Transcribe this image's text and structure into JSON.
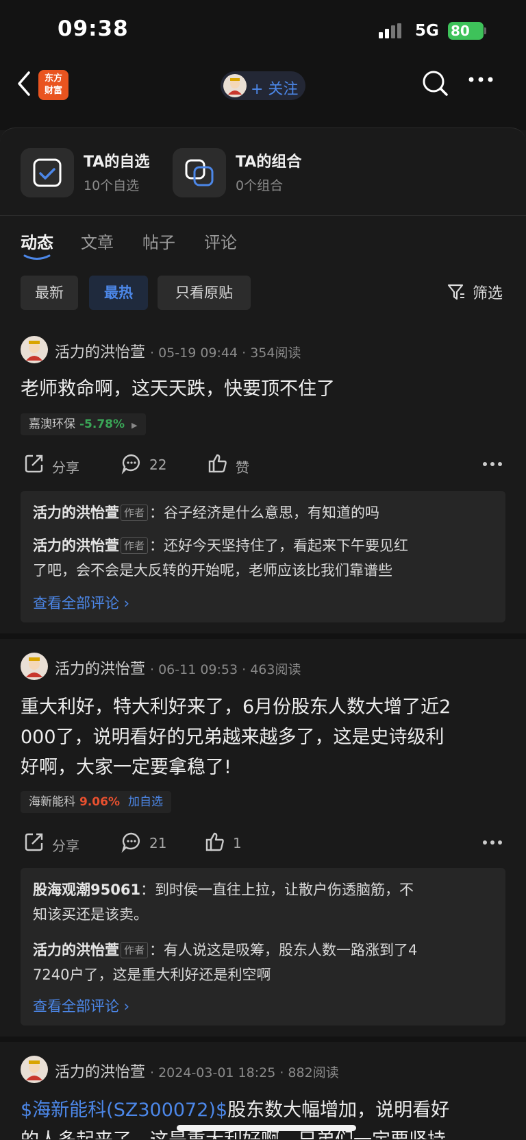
{
  "status": {
    "time": "09:38",
    "network": "5G",
    "battery": "80"
  },
  "nav": {
    "logo_text": "东方\n财富",
    "follow": "+ 关注"
  },
  "cards": [
    {
      "title": "TA的自选",
      "sub": "10个自选"
    },
    {
      "title": "TA的组合",
      "sub": "0个组合"
    }
  ],
  "tabs": [
    "动态",
    "文章",
    "帖子",
    "评论"
  ],
  "chips": [
    "最新",
    "最热",
    "只看原贴"
  ],
  "filter": "筛选",
  "posts": [
    {
      "author": "活力的洪怡萱",
      "meta": "· 05-19 09:44 · 354阅读",
      "lines": [
        "老师救命啊，这天天跌，快要顶不住了"
      ],
      "stock_name": "嘉澳环保",
      "stock_change": "-5.78%",
      "share": "分享",
      "comments": "22",
      "likes": "赞",
      "replies": [
        {
          "name": "活力的洪怡萱",
          "tag": "作者",
          "lines": [
            "：谷子经济是什么意思，有知道的吗"
          ]
        },
        {
          "name": "活力的洪怡萱",
          "tag": "作者",
          "lines": [
            "：还好今天坚持住了，看起来下午要见红",
            "了吧，会不会是大反转的开始呢，老师应该比我们靠谱些"
          ]
        }
      ],
      "see_all": "查看全部评论 ›"
    },
    {
      "author": "活力的洪怡萱",
      "meta": "· 06-11 09:53 · 463阅读",
      "lines": [
        "重大利好，特大利好来了，6月份股东人数大增了近2",
        "000了，说明看好的兄弟越来越多了，这是史诗级利",
        "好啊，大家一定要拿稳了!"
      ],
      "stock_name": "海新能科",
      "stock_change": "9.06%",
      "stock_add": "加自选",
      "share": "分享",
      "comments": "21",
      "likes": "1",
      "replies": [
        {
          "name": "股海观潮95061",
          "lines": [
            "：到时侯一直往上拉，让散户伤透脑筋，不",
            "知该买还是该卖。"
          ]
        },
        {
          "name": "活力的洪怡萱",
          "tag": "作者",
          "lines": [
            "：有人说这是吸筹，股东人数一路涨到了4",
            "7240户了，这是重大利好还是利空啊"
          ]
        }
      ],
      "see_all": "查看全部评论 ›"
    },
    {
      "author": "活力的洪怡萱",
      "meta": "· 2024-03-01 18:25 · 882阅读",
      "link": "$海新能科(SZ300072)$",
      "line1_rest": "股东数大幅增加，说明看好",
      "line2": "的人多起来了，这是重大利好啊，兄弟们一定要坚持"
    }
  ]
}
